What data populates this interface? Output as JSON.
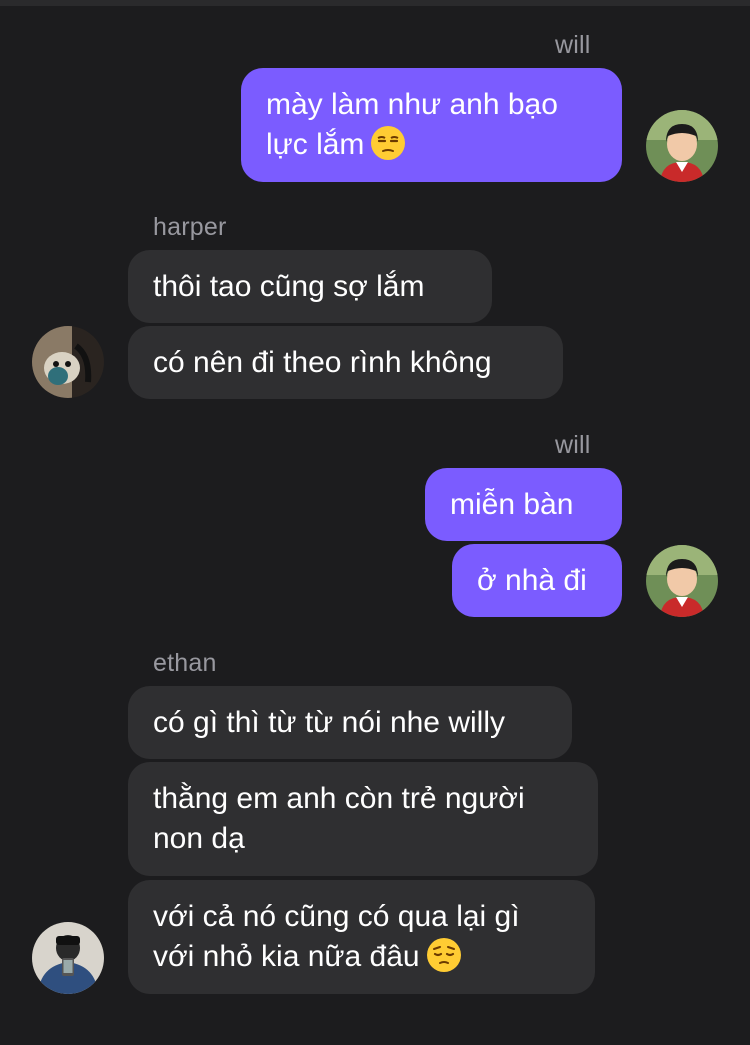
{
  "messages": {
    "group1": {
      "sender": "will",
      "bubble1": {
        "text": "mày làm như anh bạo\nlực lắm",
        "emoji": "unamused-face"
      }
    },
    "group2": {
      "sender": "harper",
      "bubble1": {
        "text": "thôi tao cũng sợ lắm"
      },
      "bubble2": {
        "text": "có nên đi theo rình không"
      }
    },
    "group3": {
      "sender": "will",
      "bubble1": {
        "text": "miễn bàn"
      },
      "bubble2": {
        "text": "ở nhà đi"
      }
    },
    "group4": {
      "sender": "ethan",
      "bubble1": {
        "text": "có gì thì từ từ nói nhe willy"
      },
      "bubble2": {
        "text": "thằng em anh còn trẻ người\nnon dạ"
      },
      "bubble3": {
        "text": "với cả nó cũng có qua lại gì\nvới nhỏ kia nữa đâu",
        "emoji": "pensive-face"
      }
    }
  },
  "colors": {
    "background": "#1c1c1e",
    "outgoing_bubble": "#7b5cff",
    "incoming_bubble": "#2f2f31",
    "sender_label": "#98989f"
  }
}
